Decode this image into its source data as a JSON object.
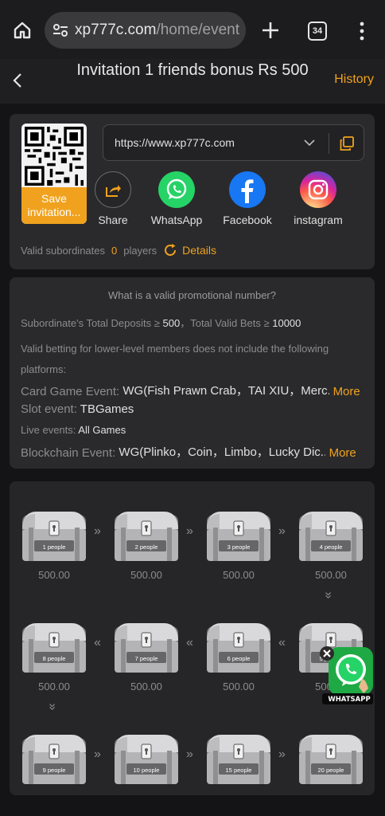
{
  "browser": {
    "url_host": "xp777c.com",
    "url_path": "/home/event",
    "tab_count": "34"
  },
  "header": {
    "title": "Invitation 1 friends bonus Rs 500",
    "history_label": "History"
  },
  "invite": {
    "save_label": "Save invitation...",
    "link": "https://www.xp777c.com",
    "share": [
      {
        "label": "Share",
        "icon": "share-icon"
      },
      {
        "label": "WhatsApp",
        "icon": "whatsapp-icon"
      },
      {
        "label": "Facebook",
        "icon": "facebook-icon"
      },
      {
        "label": "instagram",
        "icon": "instagram-icon"
      }
    ],
    "valid_label": "Valid subordinates",
    "valid_count": "0",
    "valid_unit": "players",
    "details_label": "Details"
  },
  "rules": {
    "title": "What is a valid promotional number?",
    "deposits_label": "Subordinate's Total Deposits ≥",
    "deposits_value": "500",
    "bets_label": "Total Valid Bets ≥",
    "bets_value": "10000",
    "exclude_line1": "Valid betting for lower-level members does not include the following",
    "exclude_line2": "platforms:",
    "card_label": "Card Game Event:",
    "card_value": "WG(Fish Prawn Crab，TAI XIU，Merc...",
    "slot_label": "Slot event:",
    "slot_value": "TBGames",
    "live_label": "Live events:",
    "live_value": "All Games",
    "blockchain_label": "Blockchain Event:",
    "blockchain_value": "WG(Plinko，Coin，Limbo，Lucky Dic...",
    "more_label": "More"
  },
  "chests": [
    {
      "label": "1 people",
      "amount": "500.00"
    },
    {
      "label": "2 people",
      "amount": "500.00"
    },
    {
      "label": "3 people",
      "amount": "500.00"
    },
    {
      "label": "4 people",
      "amount": "500.00"
    },
    {
      "label": "8 people",
      "amount": "500.00"
    },
    {
      "label": "7 people",
      "amount": "500.00"
    },
    {
      "label": "6 people",
      "amount": "500.00"
    },
    {
      "label": "5 people",
      "amount": "500.00"
    },
    {
      "label": "9 people",
      "amount": ""
    },
    {
      "label": "10 people",
      "amount": ""
    },
    {
      "label": "15 people",
      "amount": ""
    },
    {
      "label": "20 people",
      "amount": ""
    }
  ],
  "float_badge": {
    "label": "WHATSAPP"
  },
  "colors": {
    "accent": "#f0a21e",
    "card": "#2a2a2c",
    "background": "#141416"
  }
}
